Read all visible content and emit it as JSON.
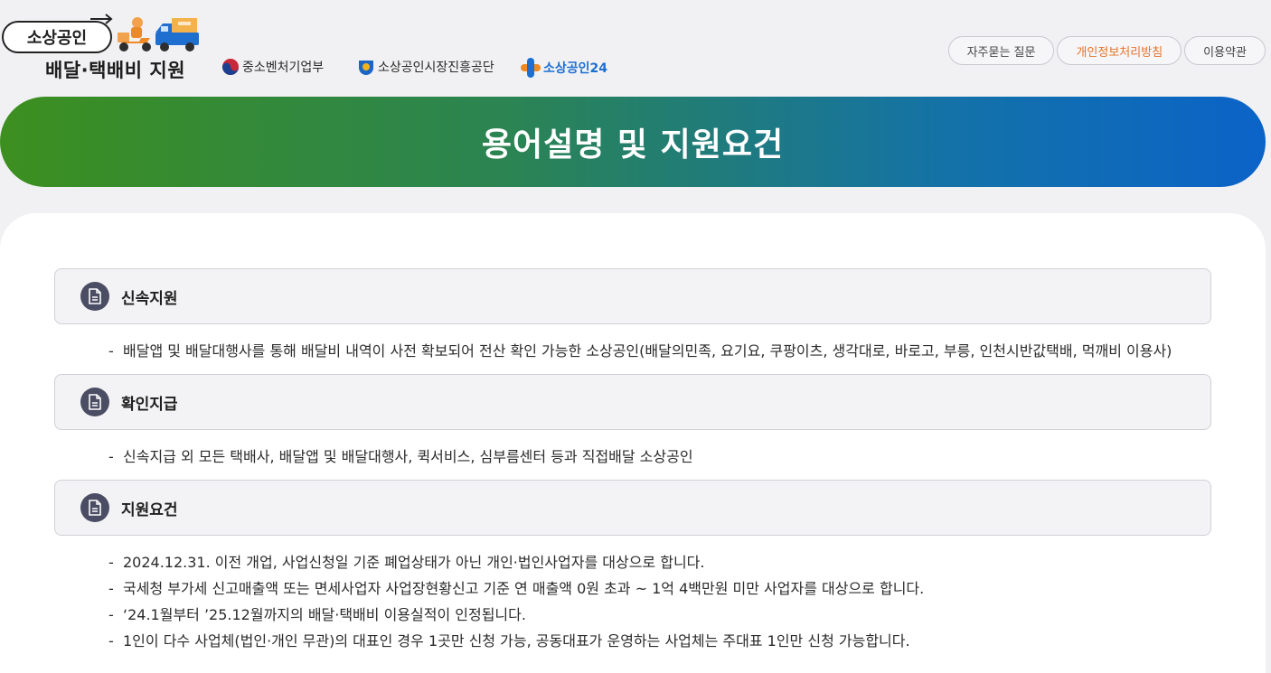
{
  "header": {
    "logo_pill": "소상공인",
    "logo_subtitle": "배달·택배비 지원",
    "orgs": {
      "mss": "중소벤처기업부",
      "semas": "소상공인시장진흥공단",
      "sb24": "소상공인24"
    },
    "links": [
      "자주묻는 질문",
      "개인정보처리방침",
      "이용약관"
    ]
  },
  "banner": {
    "title": "용어설명 및 지원요건"
  },
  "sections": [
    {
      "title": "신속지원",
      "bullets": [
        "배달앱 및 배달대행사를 통해 배달비 내역이 사전 확보되어 전산 확인 가능한 소상공인(배달의민족, 요기요, 쿠팡이츠, 생각대로, 바로고, 부릉, 인천시반값택배, 먹깨비 이용사)"
      ]
    },
    {
      "title": "확인지급",
      "bullets": [
        "신속지급 외 모든 택배사, 배달앱 및 배달대행사, 퀵서비스, 심부름센터 등과 직접배달 소상공인"
      ]
    },
    {
      "title": "지원요건",
      "bullets": [
        "2024.12.31. 이전 개업, 사업신청일 기준 폐업상태가 아닌 개인·법인사업자를 대상으로 합니다.",
        "국세청 부가세 신고매출액 또는 면세사업자 사업장현황신고 기준 연 매출액 0원 초과 ~ 1억 4백만원 미만 사업자를 대상으로 합니다.",
        "‘24.1월부터 ’25.12월까지의 배달·택배비 이용실적이 인정됩니다.",
        "1인이 다수 사업체(법인·개인 무관)의 대표인 경우 1곳만 신청 가능, 공동대표가 운영하는 사업체는 주대표 1인만 신청 가능합니다."
      ]
    }
  ],
  "bullet_dash": "-",
  "colors": {
    "banner_start": "#3c8f1f",
    "banner_end": "#0b63c8",
    "accent_link": "#e5732b",
    "icon_bg": "#4a4d63"
  }
}
